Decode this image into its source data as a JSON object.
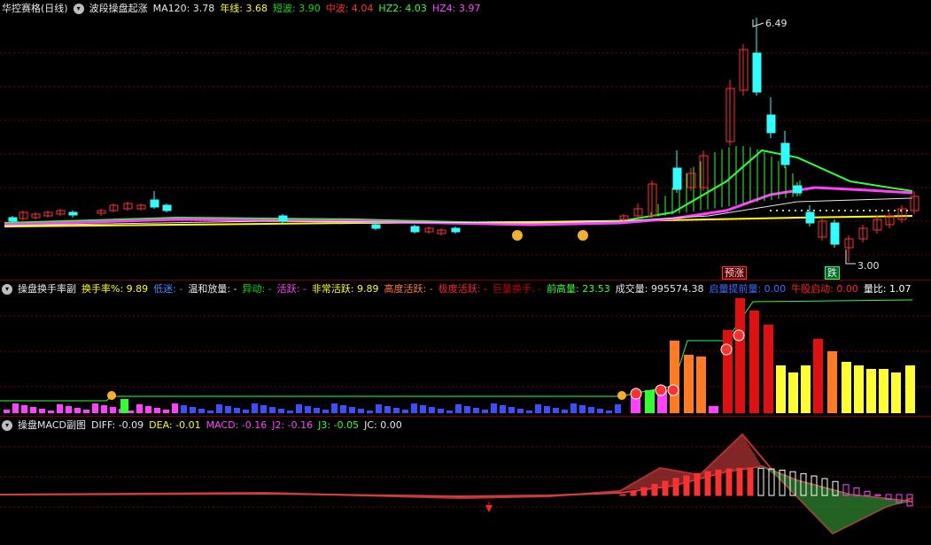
{
  "main": {
    "title": "华控赛格(日线)",
    "indicator_name": "波段操盘起涨",
    "indicators": [
      {
        "label": "MA120:",
        "value": "3.78",
        "color": "#e8e8e8"
      },
      {
        "label": "年线:",
        "value": "3.68",
        "color": "#ffff00"
      },
      {
        "label": "短波:",
        "value": "3.90",
        "color": "#00e000"
      },
      {
        "label": "中波:",
        "value": "4.04",
        "color": "#ff3030"
      },
      {
        "label": "HZ2:",
        "value": "4.03",
        "color": "#30ff30"
      },
      {
        "label": "HZ4:",
        "value": "3.97",
        "color": "#ff40ff"
      }
    ],
    "high_label": "6.49",
    "low_label": "3.00",
    "tag_yuzhang": "预涨",
    "tag_die": "跌"
  },
  "vol": {
    "indicator_name": "操盘换手率副",
    "fields": [
      {
        "label": "换手率%:",
        "value": "9.89",
        "color": "#ffff00"
      },
      {
        "label": "低迷:",
        "value": "-",
        "color": "#3a8cff"
      },
      {
        "label": "温和放量:",
        "value": "-",
        "color": "#e8e8e8"
      },
      {
        "label": "异动:",
        "value": "-",
        "color": "#00e000"
      },
      {
        "label": "活跃:",
        "value": "-",
        "color": "#ff40ff"
      },
      {
        "label": "非常活跃:",
        "value": "9.89",
        "color": "#ffff00"
      },
      {
        "label": "高度活跃:",
        "value": "-",
        "color": "#ff7a30"
      },
      {
        "label": "极度活跃:",
        "value": "-",
        "color": "#ff2020"
      },
      {
        "label": "巨量换手:",
        "value": "-",
        "color": "#c00000"
      },
      {
        "label": "前高量:",
        "value": "23.53",
        "color": "#30ff30"
      },
      {
        "label": "成交量:",
        "value": "995574.38",
        "color": "#e8e8e8"
      },
      {
        "label": "启量提前量:",
        "value": "0.00",
        "color": "#3a6cff"
      },
      {
        "label": "牛股启动:",
        "value": "0.00",
        "color": "#ff2020"
      },
      {
        "label": "量比:",
        "value": "1.07",
        "color": "#ffffff"
      }
    ]
  },
  "macd": {
    "indicator_name": "操盘MACD副图",
    "fields": [
      {
        "label": "DIFF:",
        "value": "-0.09",
        "color": "#e8e8e8"
      },
      {
        "label": "DEA:",
        "value": "-0.01",
        "color": "#ffff00"
      },
      {
        "label": "MACD:",
        "value": "-0.16",
        "color": "#ff40ff"
      },
      {
        "label": "J2:",
        "value": "-0.16",
        "color": "#ff40ff"
      },
      {
        "label": "J3:",
        "value": "-0.05",
        "color": "#30ff30"
      },
      {
        "label": "JC:",
        "value": "0.00",
        "color": "#e8e8e8"
      }
    ]
  }
}
